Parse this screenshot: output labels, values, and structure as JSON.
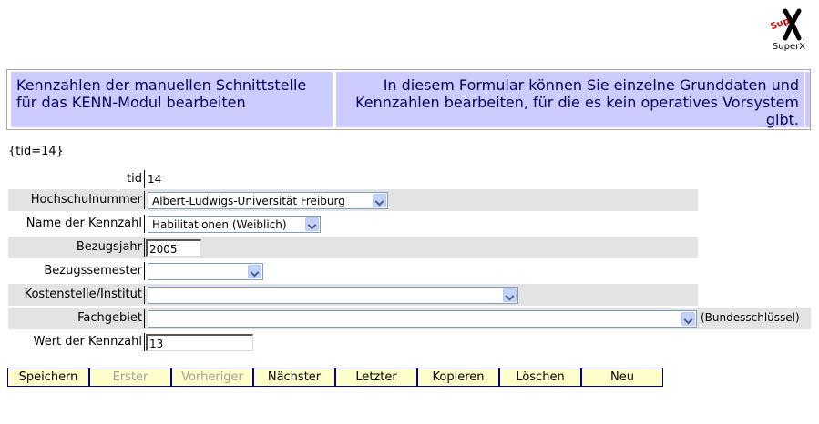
{
  "logo": {
    "text": "SuperX",
    "mark": "Sup"
  },
  "header": {
    "title": "Kennzahlen der manuellen Schnittstelle für das KENN-Modul bearbeiten",
    "description": "In diesem Formular können Sie einzelne Grunddaten und Kennzahlen bearbeiten, für die es kein operatives Vorsystem gibt."
  },
  "tid_note": "{tid=14}",
  "form": {
    "tid": {
      "label": "tid",
      "value": "14"
    },
    "hochschulnummer": {
      "label": "Hochschulnummer",
      "value": "Albert-Ludwigs-Universität Freiburg"
    },
    "kennzahl_name": {
      "label": "Name der Kennzahl",
      "value": "Habilitationen (Weiblich)"
    },
    "bezugsjahr": {
      "label": "Bezugsjahr",
      "value": "2005"
    },
    "bezugssemester": {
      "label": "Bezugssemester",
      "value": ""
    },
    "kostenstelle": {
      "label": "Kostenstelle/Institut",
      "value": ""
    },
    "fachgebiet": {
      "label": "Fachgebiet",
      "value": "",
      "note": "(Bundesschlüssel)"
    },
    "wert": {
      "label": "Wert der Kennzahl",
      "value": "13"
    }
  },
  "buttons": {
    "save": "Speichern",
    "first": "Erster",
    "previous": "Vorheriger",
    "next": "Nächster",
    "last": "Letzter",
    "copy": "Kopieren",
    "delete": "Löschen",
    "new": "Neu"
  }
}
